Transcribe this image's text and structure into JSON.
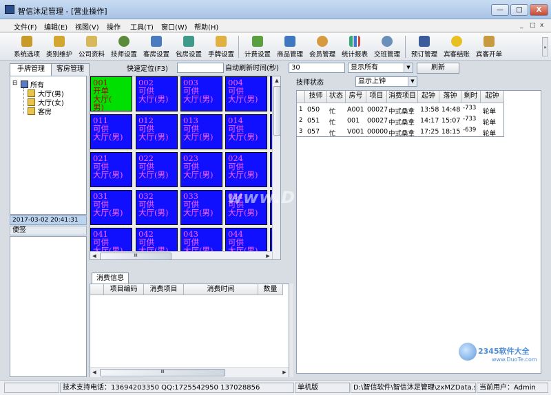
{
  "window": {
    "title": "智信沐足管理 - [营业操作]",
    "min": "—",
    "max": "□",
    "close": "X"
  },
  "mdi": {
    "min": "_",
    "restore": "□",
    "close": "x"
  },
  "menu": [
    "文件(F)",
    "编辑(E)",
    "视图(V)",
    "操作",
    "工具(T)",
    "窗口(W)",
    "帮助(H)"
  ],
  "toolbar": [
    "系统选项",
    "类别维护",
    "公司资料",
    "技师设置",
    "客房设置",
    "包房设置",
    "手牌设置",
    "计费设置",
    "商品管理",
    "会员管理",
    "统计报表",
    "交班管理",
    "预订管理",
    "宾客结账",
    "宾客开单"
  ],
  "left_tabs": [
    "手牌管理",
    "客房管理"
  ],
  "tree": {
    "root": "所有",
    "expander": "⊟",
    "children": [
      "大厅(男)",
      "大厅(女)",
      "客房"
    ]
  },
  "datetime": "2017-03-02 20:41:31",
  "memo_label": "便签",
  "quick_locate_label": "快速定位(F3)",
  "refresh": {
    "label": "自动刷新时间(秒)",
    "value": "30",
    "filter": "显示所有",
    "button": "刷新"
  },
  "rooms": [
    {
      "code": "001",
      "state": "开单",
      "area": "大厅(",
      "area2": "男)",
      "busy": true
    },
    {
      "code": "002",
      "state": "可供",
      "area": "大厅(男)"
    },
    {
      "code": "003",
      "state": "可供",
      "area": "大厅(男)"
    },
    {
      "code": "004",
      "state": "可供",
      "area": "大厅(男)"
    },
    {
      "code": "00",
      "state": "可",
      "area": "大"
    },
    {
      "code": "011",
      "state": "可供",
      "area": "大厅(男)"
    },
    {
      "code": "012",
      "state": "可供",
      "area": "大厅(男)"
    },
    {
      "code": "013",
      "state": "可供",
      "area": "大厅(男)"
    },
    {
      "code": "014",
      "state": "可供",
      "area": "大厅(男)"
    },
    {
      "code": "01",
      "state": "可",
      "area": "大"
    },
    {
      "code": "021",
      "state": "可供",
      "area": "大厅(男)"
    },
    {
      "code": "022",
      "state": "可供",
      "area": "大厅(男)"
    },
    {
      "code": "023",
      "state": "可供",
      "area": "大厅(男)"
    },
    {
      "code": "024",
      "state": "可供",
      "area": "大厅(男)"
    },
    {
      "code": "02",
      "state": "可",
      "area": "大"
    },
    {
      "code": "031",
      "state": "可供",
      "area": "大厅(男)"
    },
    {
      "code": "032",
      "state": "可供",
      "area": "大厅(男)"
    },
    {
      "code": "033",
      "state": "可供",
      "area": "大厅(男)"
    },
    {
      "code": "034",
      "state": "可供",
      "area": "大厅(男)"
    },
    {
      "code": "03",
      "state": "可",
      "area": "大"
    },
    {
      "code": "041",
      "state": "可供",
      "area": "大厅(男)"
    },
    {
      "code": "042",
      "state": "可供",
      "area": "大厅(男)"
    },
    {
      "code": "043",
      "state": "可供",
      "area": "大厅(男)"
    },
    {
      "code": "044",
      "state": "可供",
      "area": "大厅(男)"
    },
    {
      "code": "04",
      "state": "可",
      "area": "大"
    }
  ],
  "scroll": {
    "thumb": "III"
  },
  "consume": {
    "tab": "消费信息",
    "columns": [
      "项目编码",
      "消费项目",
      "消费时间",
      "数量"
    ]
  },
  "tech": {
    "label": "技师状态",
    "filter": "显示上钟",
    "columns": [
      "技师",
      "状态",
      "房号",
      "项目",
      "消费项目",
      "起钟",
      "落钟",
      "剩时",
      "起钟"
    ],
    "rows": [
      [
        "1",
        "050",
        "忙",
        "A001",
        "00027",
        "中式桑拿",
        "13:58",
        "14:48",
        "-733",
        "轮单"
      ],
      [
        "2",
        "051",
        "忙",
        "001",
        "00027",
        "中式桑拿",
        "14:17",
        "15:07",
        "-733",
        "轮单"
      ],
      [
        "3",
        "057",
        "忙",
        "V001",
        "00000",
        "中式桑拿",
        "17:25",
        "18:15",
        "-639",
        "轮单"
      ]
    ]
  },
  "watermark": "www.DuoTe.com",
  "logo": {
    "brand": "2345软件大全",
    "url": "www.DuoTe.com"
  },
  "status": {
    "support": "技术支持电话：13694203350 QQ:1725542950 137028856",
    "mode": "单机版",
    "path": "D:\\智信软件\\智信沐足管理\\zxMZData.sys",
    "user_label": "当前用户：",
    "user": "Admin"
  },
  "colors": {
    "room_free": "#1010ff",
    "room_busy": "#00e000",
    "room_text": "#ff60ff"
  }
}
